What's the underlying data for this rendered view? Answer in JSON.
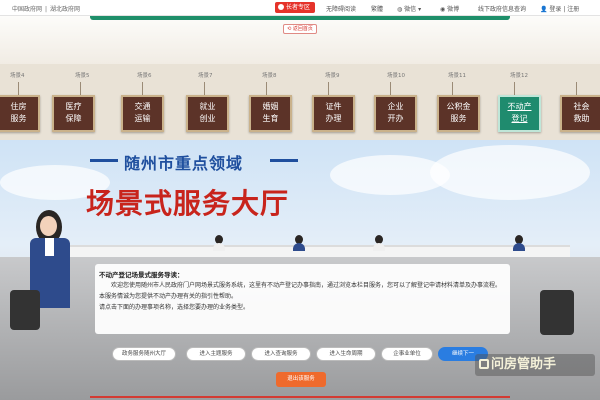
{
  "topbar": {
    "gov_link": "中国政府网",
    "sep": "|",
    "prov_link": "湖北政府网",
    "elder_mode": "长者专区",
    "barrier_free": "无障碍阅读",
    "weibo_item": "繁體",
    "wechat": "微信",
    "weibo": "微博",
    "offline": "线下政府信息查询",
    "login": "登录 | 注册"
  },
  "header": {
    "back_label": "返回首页"
  },
  "scenes": {
    "labels": [
      "场景4",
      "场景5",
      "场景6",
      "场景7",
      "场景8",
      "场景9",
      "场景10",
      "场景11",
      "场景12"
    ],
    "cards": [
      {
        "line1": "住房",
        "line2": "服务"
      },
      {
        "line1": "医疗",
        "line2": "保障"
      },
      {
        "line1": "交通",
        "line2": "运输"
      },
      {
        "line1": "就业",
        "line2": "创业"
      },
      {
        "line1": "婚姻",
        "line2": "生育"
      },
      {
        "line1": "证件",
        "line2": "办理"
      },
      {
        "line1": "企业",
        "line2": "开办"
      },
      {
        "line1": "公积金",
        "line2": "服务"
      },
      {
        "line1": "不动产",
        "line2": "登记"
      },
      {
        "line1": "社会",
        "line2": "救助"
      }
    ]
  },
  "banner": {
    "subtitle": "随州市重点领域",
    "title": "场景式服务大厅"
  },
  "guide": {
    "title": "不动产登记场景式服务导读：",
    "para1": "欢迎您使用随州市人民政府门户网场景式服务系统，这里有不动产登记办事指南，通过浏览本栏目服务，您可以了解登记申请材料清单及办事流程。本服务情诚为您提供不动产办理有关的指引性帮助。",
    "para2": "请点击下面的办理事项名称，选择您要办理的业务类型。"
  },
  "nav_buttons": {
    "b1": "政务服务随州大厅",
    "b2": "进入主题服务",
    "b3": "进入查询服务",
    "b4": "进入生命周期",
    "b5": "企事业单位",
    "b6": "继续下一"
  },
  "exit_label": "退出该服务",
  "watermark": "问房管助手",
  "colors": {
    "card_bg": "#5c3328",
    "card_active": "#1f8b6e",
    "title_red": "#c8241c",
    "title_blue": "#1f4f9e",
    "elder_red": "#e5332a",
    "exit_orange": "#ef6a2c"
  }
}
